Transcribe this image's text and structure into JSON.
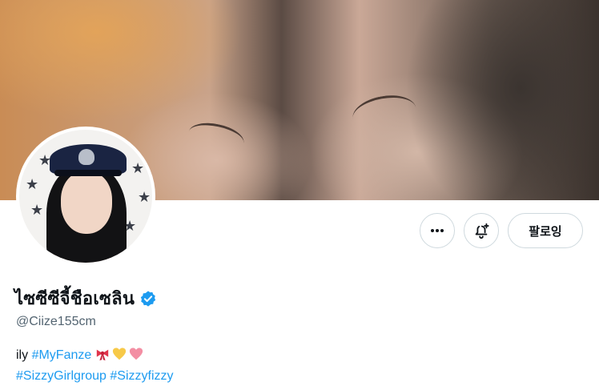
{
  "header": {
    "banner_icon": "banner-image",
    "avatar_icon": "profile-avatar"
  },
  "actions": {
    "more_icon": "more-icon",
    "notify_icon": "notification-bell-plus-icon",
    "follow_label": "팔로잉"
  },
  "profile": {
    "display_name": "ไซซีซีจี้ชือเซลิน",
    "verified_icon": "verified-badge-icon",
    "handle": "@Ciize155cm",
    "bio_line1_text": "ily ",
    "bio_hashtag_1": "#MyFanze",
    "bio_emojis": [
      "ribbon",
      "yellow-heart",
      "pink-heart"
    ],
    "bio_hashtag_2": "#SizzyGirlgroup",
    "bio_hashtag_3": "#Sizzyfizzy"
  },
  "colors": {
    "accent": "#1d9bf0",
    "text": "#0f1419",
    "muted": "#536471",
    "border": "#cfd9de"
  }
}
